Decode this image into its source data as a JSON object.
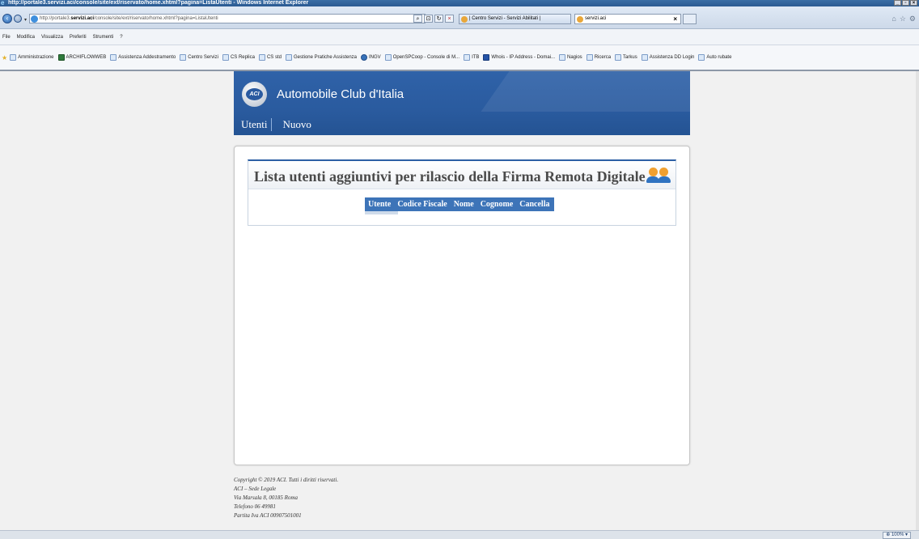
{
  "window": {
    "title": "http://portale3.servizi.aci/console/site/ext/riservato/home.xhtml?pagina=ListaUtenti - Windows Internet Explorer",
    "controls": [
      "_",
      "▫",
      "×"
    ]
  },
  "address_bar": {
    "url_prefix": "http://portale3.",
    "url_domain": "servizi.aci",
    "url_suffix": "/console/site/ext/riservato/home.xhtml?pagina=ListaUtenti"
  },
  "tabs": [
    {
      "label": "| Centro Servizi - Servizi Abilitati |"
    },
    {
      "label": "servizi.aci",
      "close": "×"
    }
  ],
  "menu": [
    "File",
    "Modifica",
    "Visualizza",
    "Preferiti",
    "Strumenti",
    "?"
  ],
  "favorites": [
    {
      "label": "Amministrazione",
      "icon": "page-icon"
    },
    {
      "label": "ARCHIFLOWWEB",
      "icon": "archiflow-icon"
    },
    {
      "label": "Assistenza Addestramento",
      "icon": "page-icon"
    },
    {
      "label": "Centro Servizi",
      "icon": "page-icon"
    },
    {
      "label": "CS Replica",
      "icon": "page-icon"
    },
    {
      "label": "CS std",
      "icon": "page-icon"
    },
    {
      "label": "Gestione Pratiche Assistenza",
      "icon": "page-icon"
    },
    {
      "label": "INGV",
      "icon": "globe-icon"
    },
    {
      "label": "OpenSPCoop - Console di M...",
      "icon": "page-icon"
    },
    {
      "label": "ITB",
      "icon": "page-icon"
    },
    {
      "label": "Whois - IP Address - Domai...",
      "icon": "whois-icon"
    },
    {
      "label": "Nagios",
      "icon": "page-icon"
    },
    {
      "label": "Ricerca",
      "icon": "page-icon"
    },
    {
      "label": "Tarkus",
      "icon": "page-icon"
    },
    {
      "label": "Assistenza DD Login",
      "icon": "page-icon"
    },
    {
      "label": "Auto rubate",
      "icon": "page-icon"
    }
  ],
  "site": {
    "brand": "Automobile Club d'Italia",
    "logo_text": "ACI",
    "nav": [
      "Utenti",
      "Nuovo"
    ]
  },
  "panel": {
    "title": "Lista utenti aggiuntivi per rilascio della Firma Remota Digitale",
    "columns": [
      "Utente",
      "Codice Fiscale",
      "Nome",
      "Cognome",
      "Cancella"
    ]
  },
  "footer": {
    "lines": [
      "Copyright © 2019 ACI. Tutti i diritti riservati.",
      "ACI – Sede Legale",
      "Via Marsala 8, 00185 Roma",
      "Telefono 06 49981",
      "Partita Iva ACI 00907501001"
    ]
  },
  "status": {
    "zoom": "100%"
  },
  "colors": {
    "header_blue": "#2a5b9f",
    "table_header": "#3d74b8"
  }
}
